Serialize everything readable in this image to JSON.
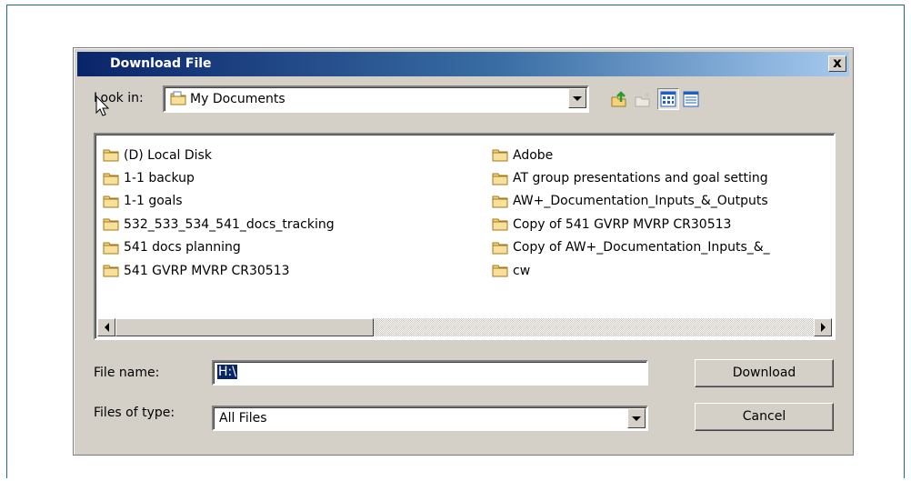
{
  "dialog": {
    "title": "Download File",
    "close_symbol": "x",
    "close_icon": "close-icon"
  },
  "lookin": {
    "label": "Look in:",
    "value": "My Documents",
    "icon": "my-documents-folder-icon",
    "toolbar_icons": [
      "up-one-level-icon",
      "create-new-folder-icon",
      "list-view-icon",
      "details-view-icon"
    ]
  },
  "files": {
    "left": [
      "(D) Local Disk",
      "1-1 backup",
      "1-1 goals",
      "532_533_534_541_docs_tracking",
      "541 docs planning",
      "541 GVRP MVRP CR30513"
    ],
    "right": [
      "Adobe",
      "AT group presentations and goal setting",
      "AW+_Documentation_Inputs_&_Outputs",
      "Copy of 541 GVRP MVRP CR30513",
      "Copy of AW+_Documentation_Inputs_&_",
      "cw"
    ]
  },
  "filename": {
    "label": "File name:",
    "value": "H:\\"
  },
  "filetype": {
    "label": "Files of type:",
    "value": "All Files"
  },
  "buttons": {
    "download": "Download",
    "cancel": "Cancel"
  },
  "colors": {
    "title_start": "#0a246a",
    "title_end": "#a6caf0",
    "face": "#d4d0c8",
    "folder": "#f5d37a"
  }
}
